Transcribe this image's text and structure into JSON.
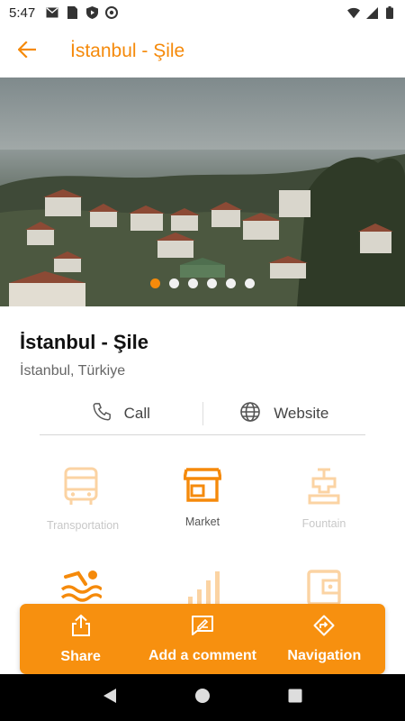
{
  "status_bar": {
    "time": "5:47",
    "left_icons": [
      "mail-icon",
      "sim-card-icon",
      "play-protect-icon",
      "at-sign-icon"
    ],
    "right_icons": [
      "wifi-icon",
      "signal-icon",
      "battery-icon"
    ]
  },
  "app_bar": {
    "back_icon": "arrow-left-icon",
    "title": "İstanbul - Şile"
  },
  "hero": {
    "carousel_count": 6,
    "active_index": 0
  },
  "place": {
    "title": "İstanbul - Şile",
    "subtitle": "İstanbul, Türkiye"
  },
  "actions": {
    "call_label": "Call",
    "website_label": "Website"
  },
  "amenities": [
    {
      "label": "Transportation",
      "icon": "bus-icon",
      "active": false
    },
    {
      "label": "Market",
      "icon": "storefront-icon",
      "active": true
    },
    {
      "label": "Fountain",
      "icon": "fountain-icon",
      "active": false
    },
    {
      "label": "",
      "icon": "swimming-icon",
      "active": true
    },
    {
      "label": "",
      "icon": "signal-bars-icon",
      "active": false
    },
    {
      "label": "",
      "icon": "wallet-icon",
      "active": false
    }
  ],
  "bottom_bar": {
    "share_label": "Share",
    "comment_label": "Add a comment",
    "navigation_label": "Navigation"
  },
  "colors": {
    "accent": "#f58a0b",
    "accent_muted": "#fbd3a3",
    "bottom_bar": "#f7900f"
  }
}
